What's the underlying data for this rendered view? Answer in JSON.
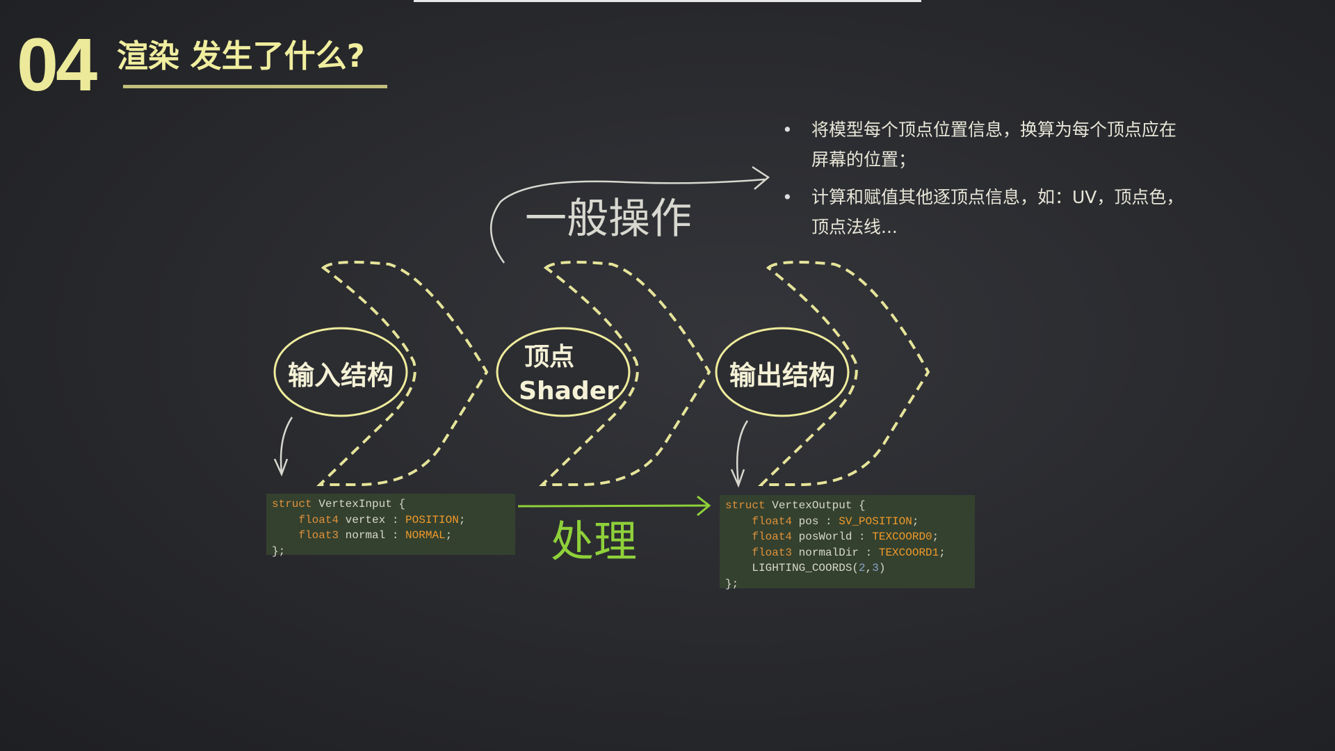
{
  "slide": {
    "number": "04",
    "title": "渲染 发生了什么?"
  },
  "bullets": [
    "将模型每个顶点位置信息，换算为每个顶点应在屏幕的位置；",
    "计算和赋值其他逐顶点信息，如：UV，顶点色，顶点法线..."
  ],
  "stages": [
    {
      "label": "输入结构"
    },
    {
      "label_line1": "顶点",
      "label_line2": "Shader"
    },
    {
      "label": "输出结构"
    }
  ],
  "annotations": {
    "general": "一般操作",
    "process": "处理"
  },
  "code_input": {
    "l0a": "struct",
    "l0b": " VertexInput {",
    "l1a": "float4",
    "l1b": " vertex : ",
    "l1c": "POSITION",
    "l1d": ";",
    "l2a": "float3",
    "l2b": " normal : ",
    "l2c": "NORMAL",
    "l2d": ";",
    "l3": "};"
  },
  "code_output": {
    "l0a": "struct",
    "l0b": " VertexOutput {",
    "l1a": "float4",
    "l1b": " pos : ",
    "l1c": "SV_POSITION",
    "l1d": ";",
    "l2a": "float4",
    "l2b": " posWorld : ",
    "l2c": "TEXCOORD0",
    "l2d": ";",
    "l3a": "float3",
    "l3b": " normalDir : ",
    "l3c": "TEXCOORD1",
    "l3d": ";",
    "l4a": "LIGHTING_COORDS(",
    "l4b": "2",
    "l4c": ",",
    "l4d": "3",
    "l4e": ")",
    "l5": "};"
  },
  "colors": {
    "chalk_yellow": "#ecea9a",
    "chalk_green": "#8fd13a",
    "code_bg": "#34412f",
    "keyword": "#e0913a"
  }
}
